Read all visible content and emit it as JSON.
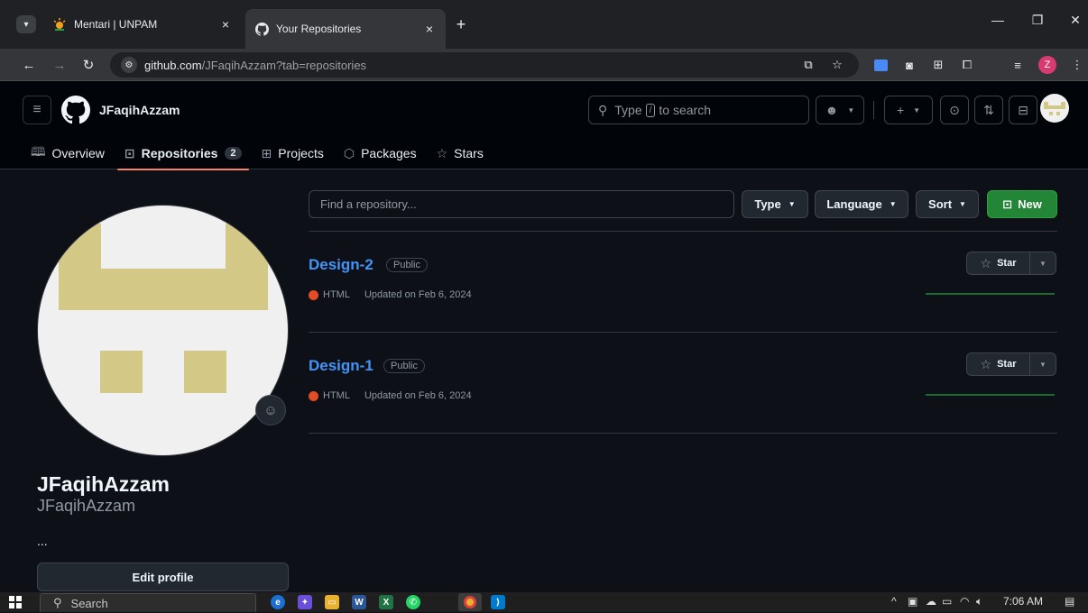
{
  "browser": {
    "tabs": [
      {
        "title": "Mentari | UNPAM",
        "active": false
      },
      {
        "title": "Your Repositories",
        "active": true
      }
    ],
    "url_host": "github.com",
    "url_path": "/JFaqihAzzam?tab=repositories",
    "profile_initial": "Z"
  },
  "github": {
    "header_username": "JFaqihAzzam",
    "search_before": "Type",
    "search_key": "/",
    "search_after": "to search",
    "nav": [
      {
        "label": "Overview"
      },
      {
        "label": "Repositories",
        "count": "2"
      },
      {
        "label": "Projects"
      },
      {
        "label": "Packages"
      },
      {
        "label": "Stars"
      }
    ]
  },
  "profile": {
    "full_name": "JFaqihAzzam",
    "username": "JFaqihAzzam",
    "bio": "...",
    "edit_button": "Edit profile"
  },
  "repo_controls": {
    "find_placeholder": "Find a repository...",
    "type_label": "Type",
    "language_label": "Language",
    "sort_label": "Sort",
    "new_label": "New"
  },
  "repositories": [
    {
      "name": "Design-2",
      "visibility": "Public",
      "language": "HTML",
      "updated": "Updated on Feb 6, 2024",
      "star_label": "Star"
    },
    {
      "name": "Design-1",
      "visibility": "Public",
      "language": "HTML",
      "updated": "Updated on Feb 6, 2024",
      "star_label": "Star"
    }
  ],
  "taskbar": {
    "search_label": "Search",
    "time": "7:06 AM"
  },
  "colors": {
    "accent_link": "#4493f8",
    "new_button": "#238636",
    "html_language": "#e34c26",
    "nav_underline": "#f78166"
  }
}
